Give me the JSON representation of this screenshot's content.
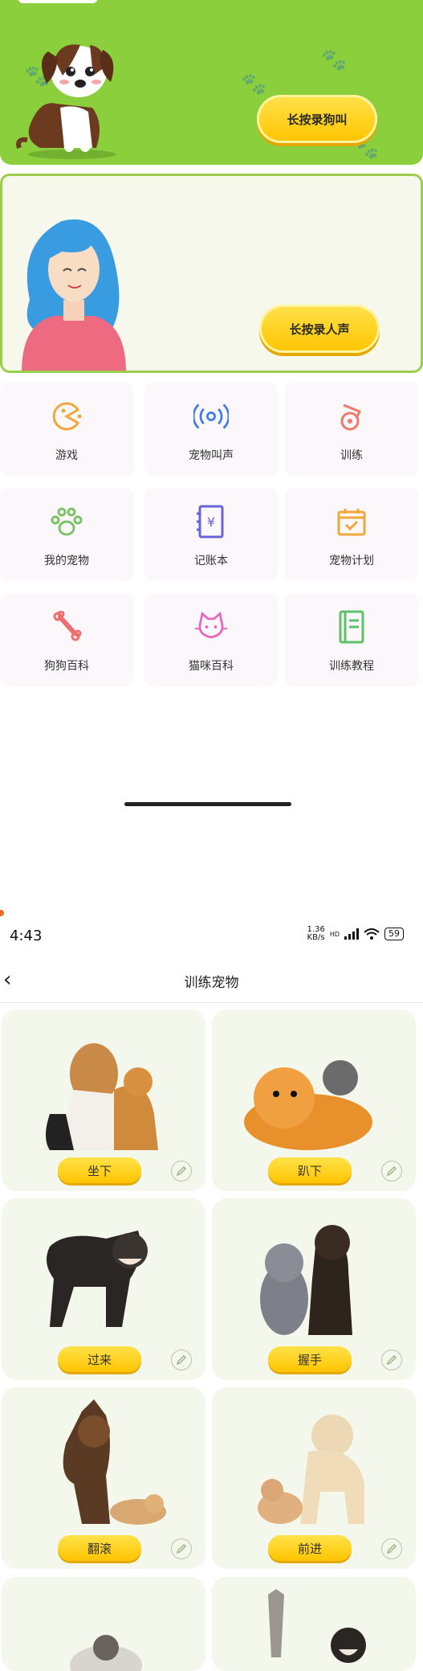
{
  "banner_dog": {
    "button_label": "长按录狗叫",
    "accent": "#8ccf3c"
  },
  "banner_human": {
    "button_label": "长按录人声",
    "accent": "#9ccd4c"
  },
  "menu": [
    {
      "label": "游戏",
      "icon": "pacman-icon",
      "color": "#f0a83a"
    },
    {
      "label": "宠物叫声",
      "icon": "sound-wave-icon",
      "color": "#3f7ee0"
    },
    {
      "label": "训练",
      "icon": "whistle-icon",
      "color": "#f07a6a"
    },
    {
      "label": "我的宠物",
      "icon": "paw-icon",
      "color": "#7cc36a"
    },
    {
      "label": "记账本",
      "icon": "ledger-icon",
      "color": "#6a64d8"
    },
    {
      "label": "宠物计划",
      "icon": "calendar-check-icon",
      "color": "#f0a83a"
    },
    {
      "label": "狗狗百科",
      "icon": "bone-icon",
      "color": "#ee6f6f"
    },
    {
      "label": "猫咪百科",
      "icon": "cat-face-icon",
      "color": "#e565c0"
    },
    {
      "label": "训练教程",
      "icon": "book-icon",
      "color": "#5fc06a"
    }
  ],
  "status_bar": {
    "time": "4:43",
    "speed": "1.36",
    "speed_unit": "KB/s",
    "network": "HD",
    "battery": "59"
  },
  "nav": {
    "title": "训练宠物"
  },
  "training": [
    {
      "label": "坐下"
    },
    {
      "label": "趴下"
    },
    {
      "label": "过来"
    },
    {
      "label": "握手"
    },
    {
      "label": "翻滚"
    },
    {
      "label": "前进"
    }
  ]
}
